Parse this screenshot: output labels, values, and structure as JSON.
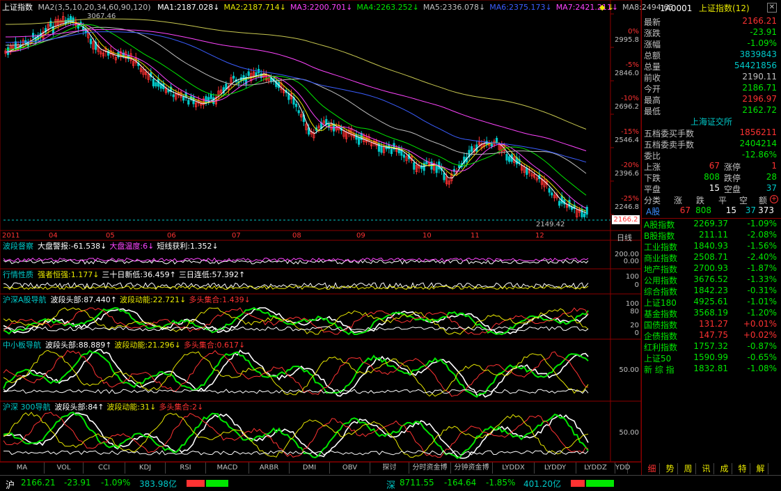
{
  "colors": {
    "red": "#ff3232",
    "green": "#00e600",
    "yellow": "#e8e800",
    "white": "#ffffff",
    "cyan": "#00c8c8",
    "magenta": "#ff44ff",
    "blue": "#3a5dff",
    "gray": "#c0c0c0",
    "grid": "#8b0000"
  },
  "header": {
    "title": "上证指数",
    "ma_params": "MA2(3,5,10,20,34,60,90,120)",
    "ma": [
      {
        "label": "MA1:2187.028",
        "arrow": "↓",
        "color": "#ffffff"
      },
      {
        "label": "MA2:2187.714",
        "arrow": "↓",
        "color": "#e8e800"
      },
      {
        "label": "MA3:2200.701",
        "arrow": "↓",
        "color": "#ff44ff"
      },
      {
        "label": "MA4:2263.252",
        "arrow": "↓",
        "color": "#00e600"
      },
      {
        "label": "MA5:2336.078",
        "arrow": "↓",
        "color": "#c0c0c0"
      },
      {
        "label": "MA6:2375.173",
        "arrow": "↓",
        "color": "#3a5dff"
      },
      {
        "label": "MA7:2421.211",
        "arrow": "↓",
        "color": "#ff44ff"
      },
      {
        "label": "MA8:2494.65",
        "arrow": "",
        "color": "#c0c0c0"
      }
    ],
    "high_marker": "3067.46",
    "low_marker": "2149.42",
    "current_tag": "2166.2"
  },
  "price_axis": [
    {
      "pct": "0%",
      "val": "2995.8"
    },
    {
      "pct": "-5%",
      "val": "2846.0"
    },
    {
      "pct": "-10%",
      "val": "2696.2"
    },
    {
      "pct": "-15%",
      "val": "2546.4"
    },
    {
      "pct": "-20%",
      "val": "2396.6"
    },
    {
      "pct": "-25%",
      "val": "2246.8"
    }
  ],
  "month_axis": {
    "year": "2011",
    "months": [
      "04",
      "05",
      "06",
      "07",
      "08",
      "09",
      "10",
      "11",
      "12"
    ],
    "period": "日线"
  },
  "panels": [
    {
      "name": "波段督察",
      "items": [
        {
          "t": "大盘警报:-61.538",
          "c": "#ffffff",
          "a": "↓"
        },
        {
          "t": "大盘温度:6",
          "c": "#ff44ff",
          "a": "↓"
        },
        {
          "t": "短线获利:1.352",
          "c": "#ffffff",
          "a": "↓"
        }
      ],
      "ticks": [
        "200.00",
        "0.00"
      ]
    },
    {
      "name": "行情性质",
      "items": [
        {
          "t": "强者恒强:1.177",
          "c": "#e8e800",
          "a": "↓"
        },
        {
          "t": "三十日新低:36.459",
          "c": "#ffffff",
          "a": "↑"
        },
        {
          "t": "三日连低:57.392",
          "c": "#ffffff",
          "a": "↑"
        }
      ],
      "ticks": [
        "100",
        "0"
      ]
    },
    {
      "name": "沪深A股导航",
      "items": [
        {
          "t": "波段头部:87.440",
          "c": "#ffffff",
          "a": "↑"
        },
        {
          "t": "波段动能:22.721",
          "c": "#e8e800",
          "a": "↓"
        },
        {
          "t": "多头集合:1.439",
          "c": "#ff3232",
          "a": "↓"
        }
      ],
      "ticks": [
        "100",
        "80",
        "20",
        "0"
      ]
    },
    {
      "name": "中小板导航",
      "items": [
        {
          "t": "波段头部:88.889",
          "c": "#ffffff",
          "a": "↑"
        },
        {
          "t": "波段动能:21.296",
          "c": "#e8e800",
          "a": "↓"
        },
        {
          "t": "多头集合:0.617",
          "c": "#ff3232",
          "a": "↓"
        }
      ],
      "ticks": [
        "50.00"
      ]
    },
    {
      "name": "沪深 300导航",
      "items": [
        {
          "t": "波段头部:84",
          "c": "#ffffff",
          "a": "↑"
        },
        {
          "t": "波段动能:31",
          "c": "#e8e800",
          "a": "↓"
        },
        {
          "t": "多头集合:2",
          "c": "#ff3232",
          "a": "↓"
        }
      ],
      "ticks": [
        "50.00"
      ]
    }
  ],
  "bottom_tabs": [
    "MA",
    "VOL",
    "CCI",
    "KDJ",
    "RSI",
    "MACD",
    "ARBR",
    "DMI",
    "OBV",
    "探讨",
    "分时资金博",
    "分钟资金博",
    "LYDDX",
    "LYDDY",
    "LYDDZ",
    "YDD"
  ],
  "quote": {
    "code": "1A0001",
    "name": "上证指数(12)",
    "rows": [
      {
        "label": "最新",
        "value": "2166.21",
        "color": "#ff3232"
      },
      {
        "label": "涨跌",
        "value": "-23.91",
        "color": "#00e600"
      },
      {
        "label": "涨幅",
        "value": "-1.09%",
        "color": "#00e600"
      },
      {
        "label": "总额",
        "value": "3839843",
        "color": "#00c8c8"
      },
      {
        "label": "总量",
        "value": "54421856",
        "color": "#00c8c8"
      },
      {
        "label": "前收",
        "value": "2190.11",
        "color": "#c0c0c0"
      },
      {
        "label": "今开",
        "value": "2186.71",
        "color": "#00e600"
      },
      {
        "label": "最高",
        "value": "2196.97",
        "color": "#ff3232"
      },
      {
        "label": "最低",
        "value": "2162.72",
        "color": "#00e600"
      }
    ],
    "exchange_title": "上海证交所",
    "order_rows": [
      {
        "label": "五档委买手数",
        "value": "1856211",
        "color": "#ff3232"
      },
      {
        "label": "五档委卖手数",
        "value": "2404214",
        "color": "#00e600"
      },
      {
        "label": "委比",
        "value": "-12.86%",
        "color": "#00e600"
      }
    ],
    "breadth": [
      {
        "l1": "上涨",
        "v1": "67",
        "c1": "#ff3232",
        "l2": "涨停",
        "v2": "1",
        "c2": "#ff3232"
      },
      {
        "l1": "下跌",
        "v1": "808",
        "c1": "#00e600",
        "l2": "跌停",
        "v2": "28",
        "c2": "#00e600"
      },
      {
        "l1": "平盘",
        "v1": "15",
        "c1": "#ffffff",
        "l2": "空盘",
        "v2": "37",
        "c2": "#00c8c8"
      }
    ],
    "class_header": [
      "分类",
      "涨",
      "跌",
      "平",
      "空",
      "额"
    ],
    "class_row": {
      "label": "A股",
      "values": [
        "67",
        "808",
        "15",
        "37",
        "373"
      ]
    },
    "indices": [
      {
        "name": "A股指数",
        "price": "2269.37",
        "chg": "-1.09%",
        "color": "#00e600"
      },
      {
        "name": "B股指数",
        "price": "211.11",
        "chg": "-2.08%",
        "color": "#00e600"
      },
      {
        "name": "工业指数",
        "price": "1840.93",
        "chg": "-1.56%",
        "color": "#00e600"
      },
      {
        "name": "商业指数",
        "price": "2508.71",
        "chg": "-2.40%",
        "color": "#00e600"
      },
      {
        "name": "地产指数",
        "price": "2700.93",
        "chg": "-1.87%",
        "color": "#00e600"
      },
      {
        "name": "公用指数",
        "price": "3676.52",
        "chg": "-1.33%",
        "color": "#00e600"
      },
      {
        "name": "综合指数",
        "price": "1842.23",
        "chg": "-0.31%",
        "color": "#00e600"
      },
      {
        "name": "上证180",
        "price": "4925.61",
        "chg": "-1.01%",
        "color": "#00e600"
      },
      {
        "name": "基金指数",
        "price": "3568.19",
        "chg": "-1.20%",
        "color": "#00e600"
      },
      {
        "name": "国债指数",
        "price": "131.27",
        "chg": "+0.01%",
        "color": "#ff3232"
      },
      {
        "name": "企债指数",
        "price": "147.75",
        "chg": "+0.02%",
        "color": "#ff3232"
      },
      {
        "name": "红利指数",
        "price": "1757.32",
        "chg": "-0.87%",
        "color": "#00e600"
      },
      {
        "name": "上证50",
        "price": "1590.99",
        "chg": "-0.65%",
        "color": "#00e600"
      },
      {
        "name": "新 综 指",
        "price": "1832.81",
        "chg": "-1.08%",
        "color": "#00e600"
      }
    ],
    "side_tabs": [
      "细",
      "势",
      "周",
      "讯",
      "成",
      "特",
      "解"
    ]
  },
  "status": {
    "sh_label": "沪",
    "sh_price": "2166.21",
    "sh_chg": "-23.91",
    "sh_pct": "-1.09%",
    "sh_amt": "383.98亿",
    "sz_label": "深",
    "sz_price": "8711.55",
    "sz_chg": "-164.64",
    "sz_pct": "-1.85%",
    "sz_amt": "401.20亿"
  }
}
